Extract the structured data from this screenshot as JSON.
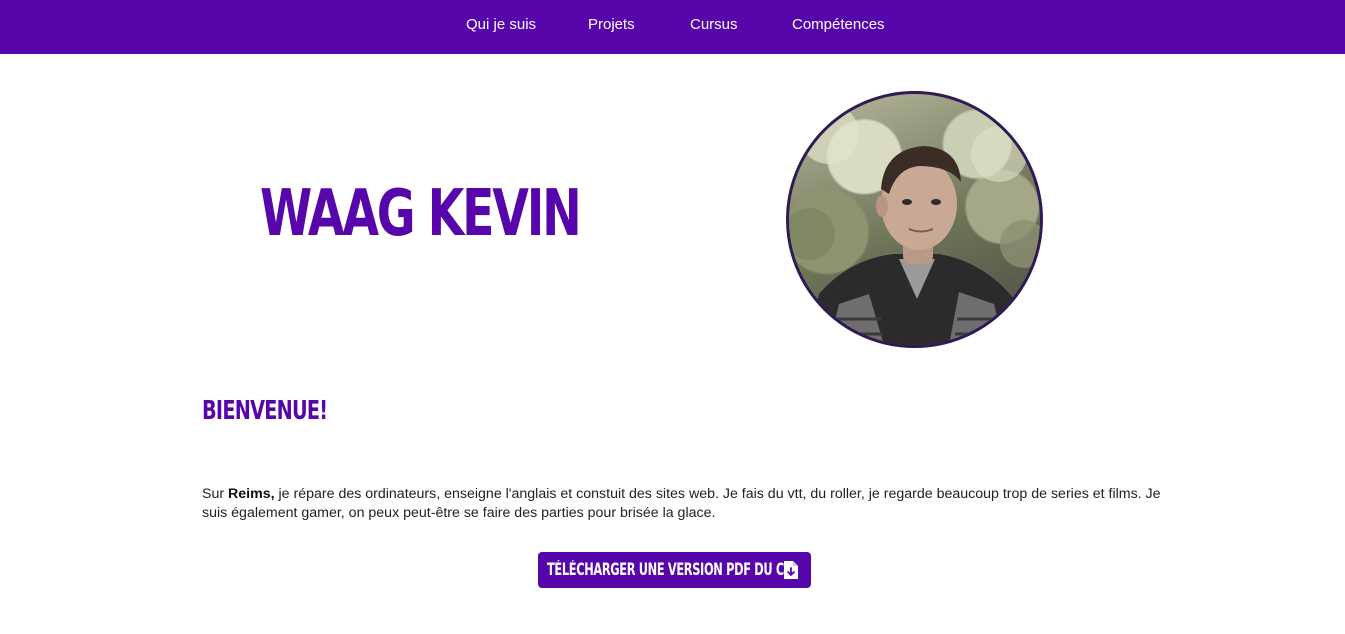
{
  "nav": {
    "items": [
      {
        "label": "Qui je suis"
      },
      {
        "label": "Projets"
      },
      {
        "label": "Cursus"
      },
      {
        "label": "Compétences"
      }
    ]
  },
  "hero": {
    "name": "WAAG KEVIN",
    "portrait_icon": "profile-photo"
  },
  "welcome": {
    "title": "BIENVENUE!",
    "intro_prefix": "Sur ",
    "intro_city": "Reims,",
    "intro_rest": " je répare des ordinateurs, enseigne l'anglais et constuit des sites web. Je fais du vtt, du roller, je regarde beaucoup trop de series et films. Je suis également gamer, on peux peut-être se faire des parties pour brisée la glace."
  },
  "cv": {
    "button_label": "TÉLÉCHARGER UNE VERSION PDF DU CV",
    "icon": "file-download-icon"
  },
  "colors": {
    "brand": "#5606aa",
    "portrait_border": "#2f1a55",
    "text": "#222222"
  }
}
